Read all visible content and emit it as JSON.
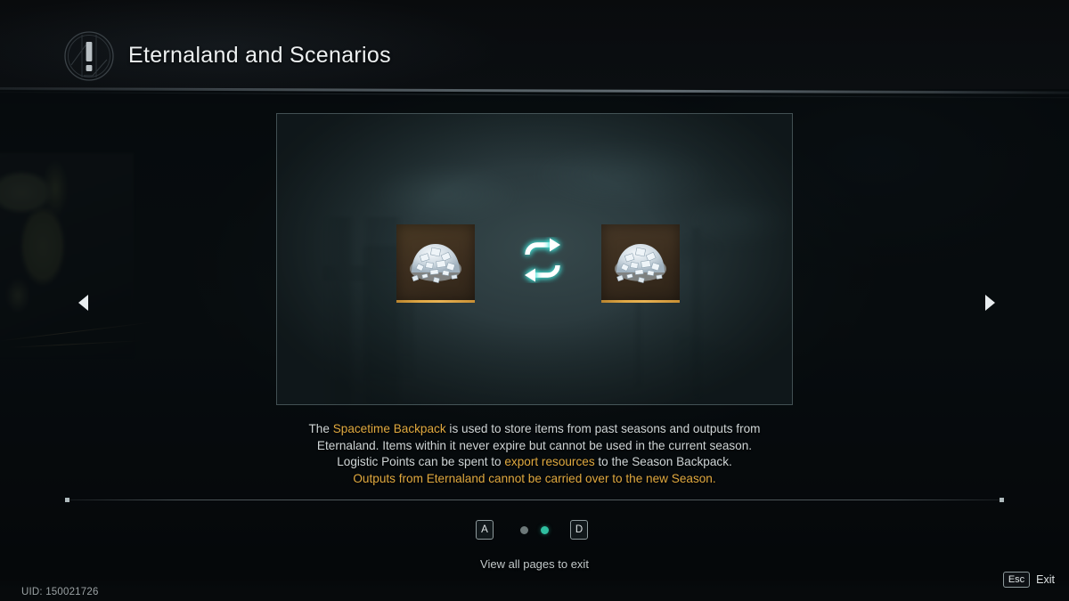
{
  "header": {
    "title": "Eternaland and Scenarios",
    "icon": "exclamation-circle-icon"
  },
  "panel": {
    "items": [
      {
        "name": "aluminum-ore",
        "label": ""
      },
      {
        "name": "aluminum-ore",
        "label": ""
      }
    ],
    "center_icon": "swap-loop-icon"
  },
  "description": {
    "line1_a": "The ",
    "line1_gold": "Spacetime Backpack",
    "line1_b": " is used to store items from past seasons and outputs from",
    "line2": "Eternaland. Items within it never expire but cannot be used in the current season.",
    "line3_a": "Logistic Points can be spent to ",
    "line3_gold": "export resources",
    "line3_b": " to the Season Backpack.",
    "line4": "Outputs from Eternaland cannot be carried over to the new Season."
  },
  "pager": {
    "prev_key": "A",
    "next_key": "D",
    "pages": [
      {
        "active": false
      },
      {
        "active": true
      }
    ],
    "active_color": "#2fbfa0",
    "inactive_color": "#6d7879"
  },
  "hint": "View all pages to exit",
  "nav": {
    "prev_icon": "chevron-left-icon",
    "next_icon": "chevron-right-icon"
  },
  "footer": {
    "uid": "UID: 150021726",
    "esc_key": "Esc",
    "exit_label": "Exit"
  },
  "colors": {
    "gold": "#e0a93f",
    "teal": "#2fbfa0",
    "panel_bg": "#2b3a3e",
    "tile_border": "#e0a845"
  }
}
